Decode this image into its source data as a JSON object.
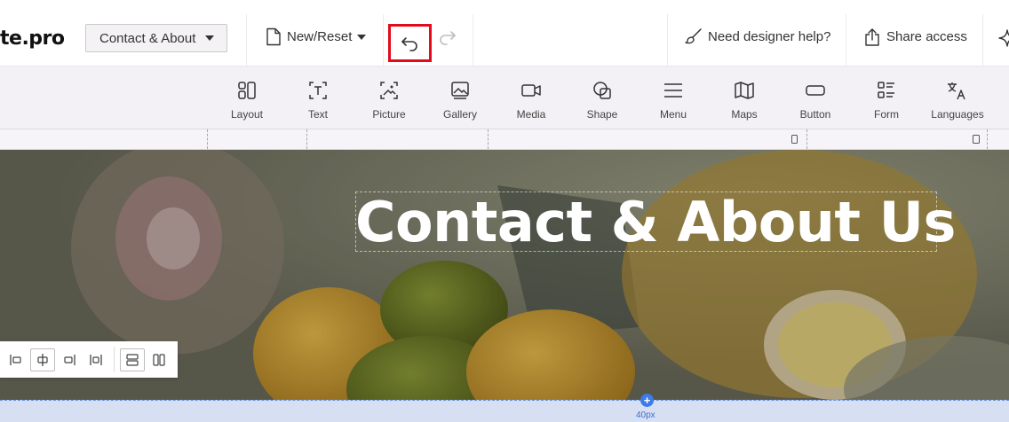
{
  "topbar": {
    "logo_text": "te.pro",
    "page_select": "Contact & About",
    "new_reset": "New/Reset",
    "designer_help": "Need designer help?",
    "share_access": "Share access"
  },
  "toolbar": {
    "items": [
      {
        "label": "Layout",
        "icon": "layout-icon"
      },
      {
        "label": "Text",
        "icon": "text-icon"
      },
      {
        "label": "Picture",
        "icon": "picture-icon"
      },
      {
        "label": "Gallery",
        "icon": "gallery-icon"
      },
      {
        "label": "Media",
        "icon": "media-icon"
      },
      {
        "label": "Shape",
        "icon": "shape-icon"
      },
      {
        "label": "Menu",
        "icon": "menu-icon"
      },
      {
        "label": "Maps",
        "icon": "maps-icon"
      },
      {
        "label": "Button",
        "icon": "button-icon"
      },
      {
        "label": "Form",
        "icon": "form-icon"
      },
      {
        "label": "Languages",
        "icon": "languages-icon"
      }
    ]
  },
  "hero": {
    "title": "Contact & About Us"
  },
  "spacing": {
    "label": "40px",
    "plus": "+"
  },
  "colors": {
    "highlight": "#e30b1c",
    "accent": "#3d7be6"
  }
}
